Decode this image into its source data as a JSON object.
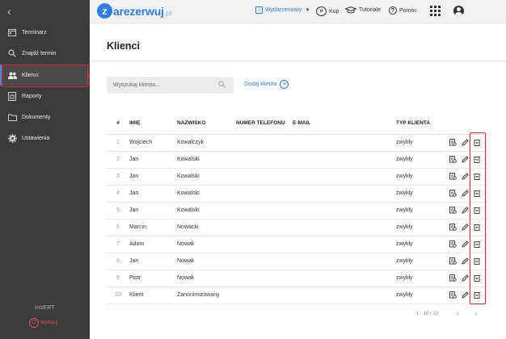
{
  "sidebar": {
    "items": [
      {
        "label": "Terminarz",
        "icon": "calendar-icon"
      },
      {
        "label": "Znajdź termin",
        "icon": "search-icon"
      },
      {
        "label": "Klienci",
        "icon": "people-icon",
        "active": true
      },
      {
        "label": "Raporty",
        "icon": "report-icon"
      },
      {
        "label": "Dokumenty",
        "icon": "folder-icon"
      },
      {
        "label": "Ustawienia",
        "icon": "gear-icon"
      }
    ],
    "brand": "InsERT",
    "logout_label": "Wyloguj"
  },
  "topbar": {
    "logo_text": "arezerwuj",
    "logo_letter": "z",
    "logo_suffix": ".pl",
    "events_label": "Wydarzeniowy",
    "buy_label": "Kup",
    "buy_icon_text": "zł",
    "tutorials_label": "Tutoriale",
    "help_label": "Pomoc"
  },
  "main": {
    "title": "Klienci",
    "search_placeholder": "Wyszukaj klienta...",
    "add_client_label": "Dodaj klienta",
    "columns": [
      "#",
      "IMIĘ",
      "NAZWISKO",
      "NUMER TELEFONU",
      "E-MAIL",
      "TYP KLIENTA"
    ],
    "rows": [
      {
        "n": "1",
        "first": "Wojciech",
        "last": "Kowalczyk",
        "phone": "",
        "email": "",
        "type": "zwykły"
      },
      {
        "n": "2",
        "first": "Jan",
        "last": "Kowalski",
        "phone": "",
        "email": "",
        "type": "zwykły"
      },
      {
        "n": "3",
        "first": "Jan",
        "last": "Kowalski",
        "phone": "",
        "email": "",
        "type": "zwykły"
      },
      {
        "n": "4",
        "first": "Jan",
        "last": "Kowalski",
        "phone": "",
        "email": "",
        "type": "zwykły"
      },
      {
        "n": "5",
        "first": "Jan",
        "last": "Kowalski",
        "phone": "",
        "email": "",
        "type": "zwykły"
      },
      {
        "n": "6",
        "first": "Marcin",
        "last": "Nowacki",
        "phone": "",
        "email": "",
        "type": "zwykły"
      },
      {
        "n": "7",
        "first": "Adam",
        "last": "Nowak",
        "phone": "",
        "email": "",
        "type": "zwykły"
      },
      {
        "n": "8",
        "first": "Jan",
        "last": "Nowak",
        "phone": "",
        "email": "",
        "type": "zwykły"
      },
      {
        "n": "9",
        "first": "Piotr",
        "last": "Nowak",
        "phone": "",
        "email": "",
        "type": "zwykły"
      },
      {
        "n": "10",
        "first": "Klient",
        "last": "Zanonimizowany",
        "phone": "",
        "email": "",
        "type": "zwykły"
      }
    ],
    "pagination": "1 - 10 / 10"
  },
  "colors": {
    "accent": "#2f7de1",
    "highlight": "#e0282e",
    "sidebar_bg": "#3b3b3b"
  }
}
